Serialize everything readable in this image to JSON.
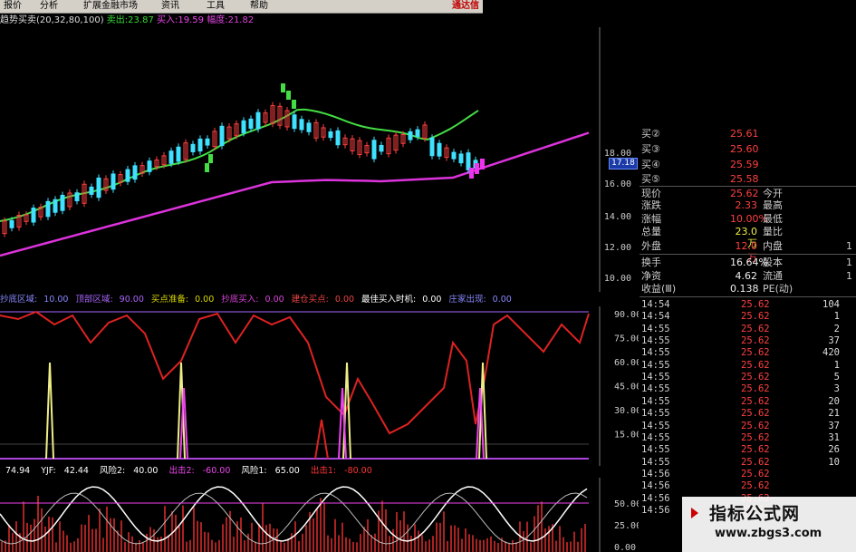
{
  "menu": {
    "items": [
      "报价",
      "分析",
      "扩展金融市场",
      "资讯",
      "工具",
      "帮助"
    ],
    "brand": "通达信"
  },
  "indicator_title": {
    "name": "趋势买卖",
    "params": "(20,32,80,100)",
    "sell_label": "卖出:",
    "sell_value": "23.87",
    "buy_label": "买入:",
    "buy_value": "19.59",
    "amp_label": "幅度:",
    "amp_value": "21.82"
  },
  "price_axis": [
    "18.00",
    "16.00",
    "14.00",
    "12.00",
    "10.00"
  ],
  "current_price_marker": "17.18",
  "quotes_bid": [
    {
      "label": "买②",
      "value": "25.61"
    },
    {
      "label": "买③",
      "value": "25.60"
    },
    {
      "label": "买④",
      "value": "25.59"
    },
    {
      "label": "买⑤",
      "value": "25.58"
    }
  ],
  "quotes_main": [
    {
      "label": "现价",
      "value": "25.62",
      "label2": "今开",
      "value3": ""
    },
    {
      "label": "涨跌",
      "value": "2.33",
      "label2": "最高",
      "value3": ""
    },
    {
      "label": "涨幅",
      "value": "10.00%",
      "label2": "最低",
      "value3": ""
    },
    {
      "label": "总量",
      "value": "23.0万",
      "label2": "量比",
      "value3": ""
    },
    {
      "label": "外盘",
      "value": "12.0万",
      "label2": "内盘",
      "value3": "1"
    }
  ],
  "quotes_fund": [
    {
      "label": "换手",
      "value": "16.64%",
      "label2": "股本",
      "value3": "1"
    },
    {
      "label": "净资",
      "value": "4.62",
      "label2": "流通",
      "value3": "1"
    },
    {
      "label": "收益(Ⅲ)",
      "value": "0.138",
      "label2": "PE(动)",
      "value3": ""
    }
  ],
  "ticks": [
    {
      "time": "14:54",
      "price": "25.62",
      "vol": "104"
    },
    {
      "time": "14:54",
      "price": "25.62",
      "vol": "1"
    },
    {
      "time": "14:55",
      "price": "25.62",
      "vol": "2"
    },
    {
      "time": "14:55",
      "price": "25.62",
      "vol": "37"
    },
    {
      "time": "14:55",
      "price": "25.62",
      "vol": "420"
    },
    {
      "time": "14:55",
      "price": "25.62",
      "vol": "1"
    },
    {
      "time": "14:55",
      "price": "25.62",
      "vol": "5"
    },
    {
      "time": "14:55",
      "price": "25.62",
      "vol": "3"
    },
    {
      "time": "14:55",
      "price": "25.62",
      "vol": "20"
    },
    {
      "time": "14:55",
      "price": "25.62",
      "vol": "21"
    },
    {
      "time": "14:55",
      "price": "25.62",
      "vol": "37"
    },
    {
      "time": "14:55",
      "price": "25.62",
      "vol": "31"
    },
    {
      "time": "14:55",
      "price": "25.62",
      "vol": "26"
    },
    {
      "time": "14:55",
      "price": "25.62",
      "vol": "10"
    },
    {
      "time": "14:56",
      "price": "25.62",
      "vol": ""
    },
    {
      "time": "14:56",
      "price": "25.62",
      "vol": ""
    },
    {
      "time": "14:56",
      "price": "25.62",
      "vol": ""
    },
    {
      "time": "14:56",
      "price": "25.62",
      "vol": ""
    }
  ],
  "indicator2": {
    "items": [
      {
        "label": "抄底区域:",
        "value": "10.00",
        "color": "#8888ff"
      },
      {
        "label": "顶部区域:",
        "value": "90.00",
        "color": "#aa66ff"
      },
      {
        "label": "买点准备:",
        "value": "0.00",
        "color": "#dddd00"
      },
      {
        "label": "抄底买入:",
        "value": "0.00",
        "color": "#dd44dd"
      },
      {
        "label": "建仓买点:",
        "value": "0.00",
        "color": "#ee4444"
      },
      {
        "label": "最佳买入时机:",
        "value": "0.00",
        "color": "#ffffff"
      },
      {
        "label": "庄家出现:",
        "value": "0.00",
        "color": "#8888ff"
      }
    ],
    "axis": [
      "90.00",
      "75.00",
      "60.00",
      "45.00",
      "30.00",
      "15.00"
    ]
  },
  "indicator3": {
    "items": [
      {
        "label": "",
        "value": "74.94",
        "color": "#ffffff"
      },
      {
        "label": "YJF:",
        "value": "42.44",
        "color": "#ffffff"
      },
      {
        "label": "风险2:",
        "value": "40.00",
        "color": "#ffffff"
      },
      {
        "label": "出击2:",
        "value": "-60.00",
        "color": "#ee44ee"
      },
      {
        "label": "风险1:",
        "value": "65.00",
        "color": "#ffffff"
      },
      {
        "label": "出击1:",
        "value": "-80.00",
        "color": "#ff3333"
      }
    ],
    "axis": [
      "50.00",
      "25.00",
      "0.00"
    ]
  },
  "watermark": {
    "title": "指标公式网",
    "url": "www.zbgs3.com"
  },
  "colors": {
    "up": "#ff4040",
    "down": "#40e0ff",
    "ma_fast": "#44dd44",
    "ma_slow": "#dd33dd"
  }
}
